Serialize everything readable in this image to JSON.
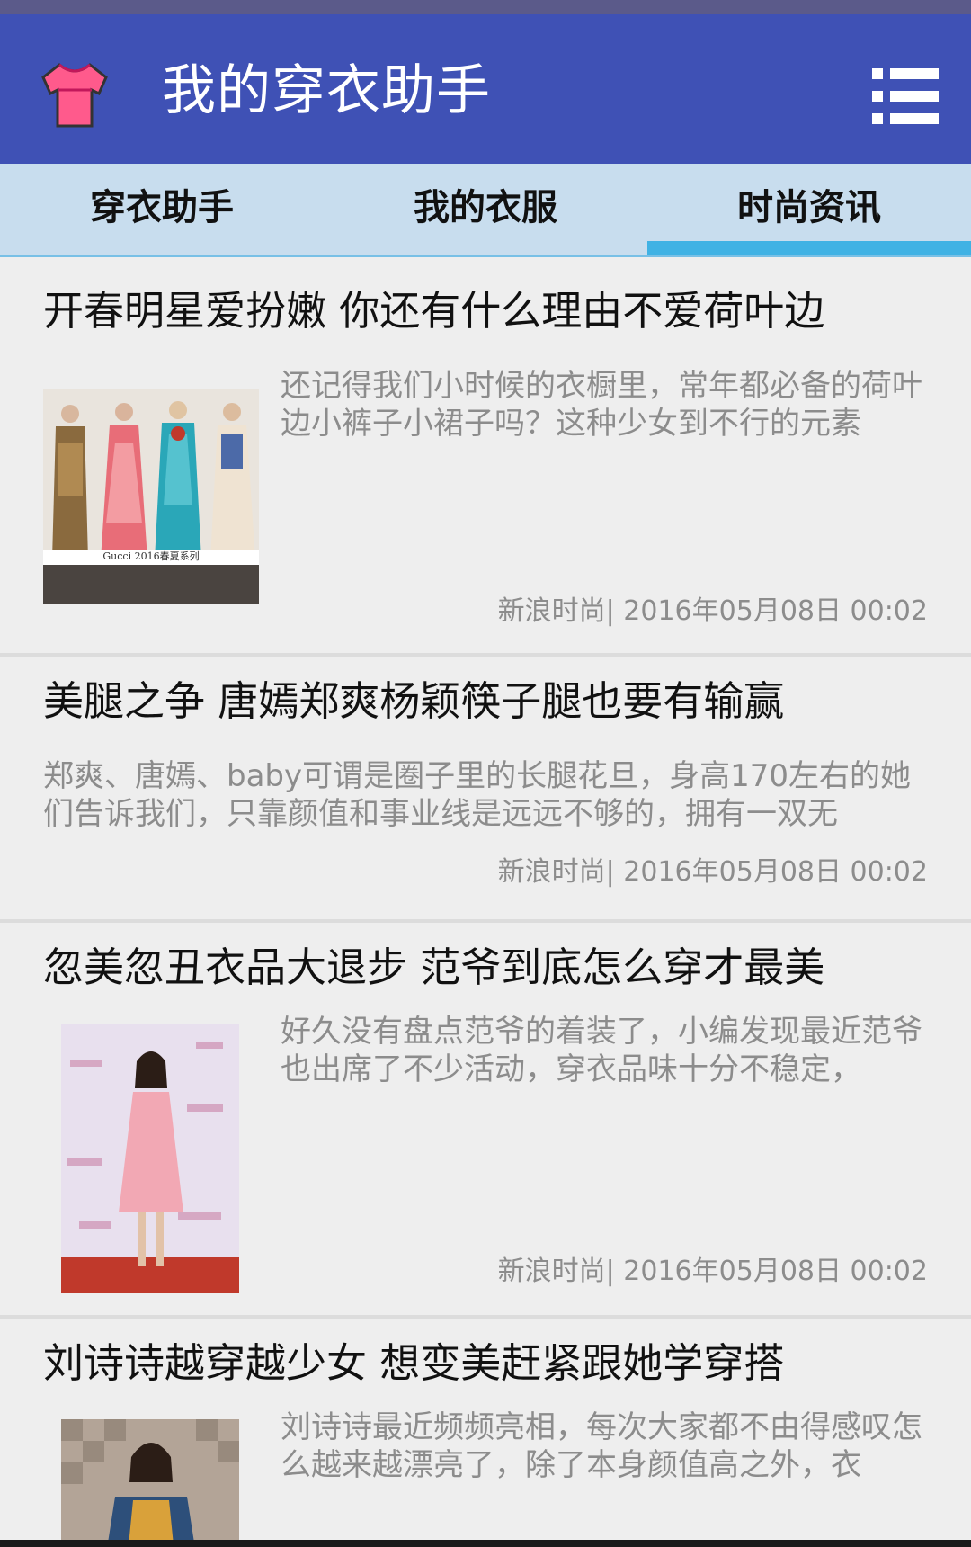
{
  "app": {
    "title": "我的穿衣助手",
    "logo_icon": "tshirt-icon",
    "menu_icon": "list-menu-icon",
    "brand_color": "#3f51b5",
    "accent_color": "#40b2e4"
  },
  "tabs": [
    {
      "label": "穿衣助手",
      "selected": false
    },
    {
      "label": "我的衣服",
      "selected": false
    },
    {
      "label": "时尚资讯",
      "selected": true
    }
  ],
  "articles": [
    {
      "title": "开春明星爱扮嫩 你还有什么理由不爱荷叶边",
      "summary": "还记得我们小时候的衣橱里，常年都必备的荷叶边小裤子小裙子吗？这种少女到不行的元素",
      "meta": "新浪时尚| 2016年05月08日 00:02",
      "image_caption": "Gucci 2016春夏系列",
      "has_image": true
    },
    {
      "title": "美腿之争 唐嫣郑爽杨颖筷子腿也要有输赢",
      "summary": "郑爽、唐嫣、baby可谓是圈子里的长腿花旦，身高170左右的她们告诉我们，只靠颜值和事业线是远远不够的，拥有一双无",
      "meta": "新浪时尚| 2016年05月08日 00:02",
      "has_image": false
    },
    {
      "title": "忽美忽丑衣品大退步 范爷到底怎么穿才最美",
      "summary": "好久没有盘点范爷的着装了，小编发现最近范爷也出席了不少活动，穿衣品味十分不稳定，",
      "meta": "新浪时尚| 2016年05月08日 00:02",
      "has_image": true
    },
    {
      "title": "刘诗诗越穿越少女 想变美赶紧跟她学穿搭",
      "summary": "刘诗诗最近频频亮相，每次大家都不由得感叹怎么越来越漂亮了，除了本身颜值高之外，衣",
      "has_image": true
    }
  ]
}
